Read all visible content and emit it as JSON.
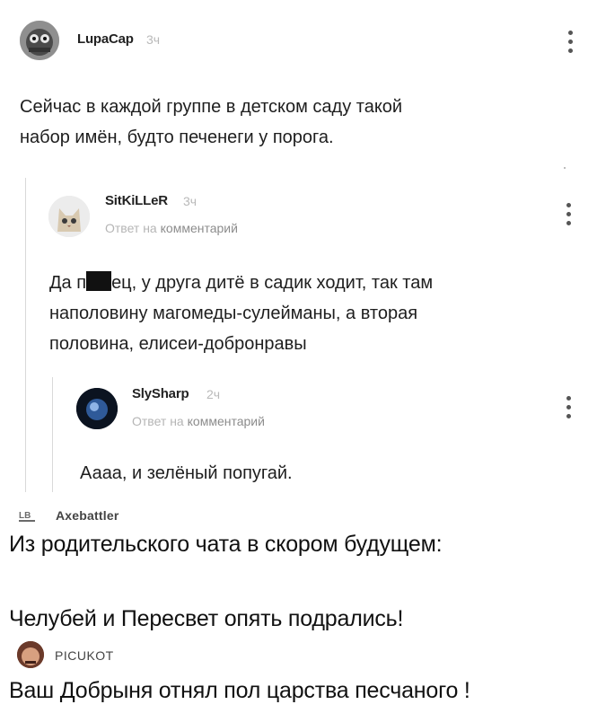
{
  "comments": [
    {
      "username": "LupaCap",
      "time": "3ч",
      "text_lines": [
        "Сейчас в каждой группе в детском саду такой",
        "набор имён, будто печенеги у порога."
      ]
    },
    {
      "username": "SitKiLLeR",
      "time": "3ч",
      "reply_prefix": "Ответ на",
      "reply_target": "комментарий",
      "line1_before": "Да п",
      "line1_after": "ец, у друга дитё в садик ходит, так там",
      "text_lines": [
        "наполовину магомеды-сулейманы, а вторая",
        "половина, елисеи-добронравы"
      ]
    },
    {
      "username": "SlySharp",
      "time": "2ч",
      "reply_prefix": "Ответ на",
      "reply_target": "комментарий",
      "text_lines": [
        "Аааа, и зелёный попугай."
      ]
    }
  ],
  "second_post": {
    "logo_text": "LB",
    "username": "Axebattler",
    "lines": [
      "Из родительского чата в скором будущем:",
      "Челубей и Пересвет опять подрались!"
    ]
  },
  "third_post": {
    "username": "PICUKOT",
    "text": "Ваш Добрыня отнял пол царства песчаного !"
  },
  "colors": {
    "thread_line": "#d9d9d9",
    "meta_gray": "#b9b9b9"
  }
}
